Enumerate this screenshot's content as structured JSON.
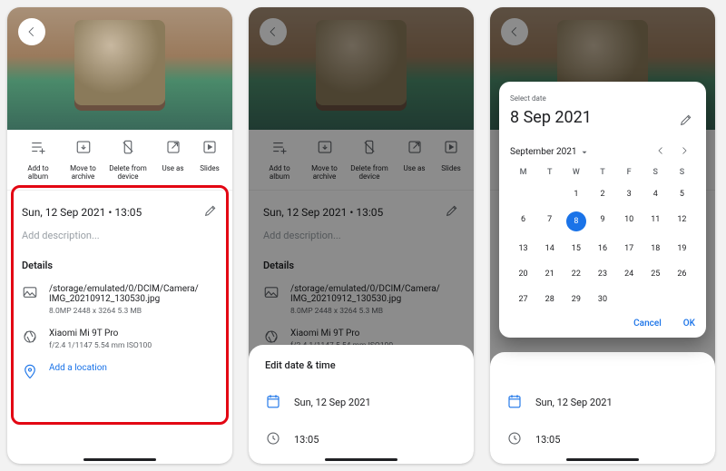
{
  "actions": {
    "add_to_album": "Add to album",
    "move_to_archive": "Move to archive",
    "delete_from_device": "Delete from device",
    "use_as": "Use as",
    "slideshow": "Slides"
  },
  "info": {
    "datetime": "Sun, 12 Sep 2021 • 13:05",
    "description_placeholder": "Add description...",
    "details_label": "Details",
    "file_path": "/storage/emulated/0/DCIM/Camera/\nIMG_20210912_130530.jpg",
    "file_meta": "8.0MP   2448 x 3264   5.3 MB",
    "camera_model": "Xiaomi Mi 9T Pro",
    "camera_meta": "f/2.4   1/1147   5.54 mm   ISO100",
    "add_location": "Add a location"
  },
  "edit_sheet": {
    "title": "Edit date & time",
    "date": "Sun, 12 Sep 2021",
    "time": "13:05"
  },
  "datepicker": {
    "label": "Select date",
    "selected_h": "8 Sep 2021",
    "month_label": "September 2021",
    "dows": [
      "M",
      "T",
      "W",
      "T",
      "F",
      "S",
      "S"
    ],
    "days": [
      "",
      "",
      "1",
      "2",
      "3",
      "4",
      "5",
      "6",
      "7",
      "8",
      "9",
      "10",
      "11",
      "12",
      "13",
      "14",
      "15",
      "16",
      "17",
      "18",
      "19",
      "20",
      "21",
      "22",
      "23",
      "24",
      "25",
      "26",
      "27",
      "28",
      "29",
      "30"
    ],
    "selected_day": "8",
    "cancel": "Cancel",
    "ok": "OK"
  }
}
